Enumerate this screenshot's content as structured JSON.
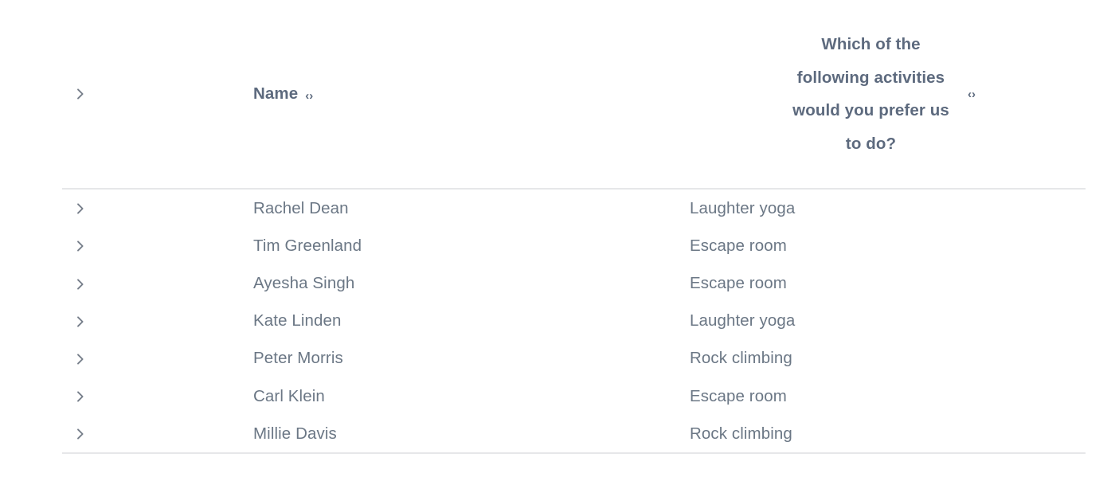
{
  "table": {
    "columns": [
      {
        "key": "expand",
        "label": "",
        "sortable": false
      },
      {
        "key": "name",
        "label": "Name",
        "sortable": true,
        "sort_icon": "‹›"
      },
      {
        "key": "question",
        "label": "Which of the following activities would you prefer us to do?",
        "sortable": true,
        "sort_icon": "‹›"
      }
    ],
    "header": {
      "expand_icon": "chevron-right-icon",
      "name_label": "Name",
      "name_sort": "‹›",
      "question_label": "Which of the following activities would you prefer us to do?",
      "question_sort": "‹›"
    },
    "rows": [
      {
        "expand_icon": "chevron-right-icon",
        "name": "Rachel Dean",
        "answer": "Laughter yoga"
      },
      {
        "expand_icon": "chevron-right-icon",
        "name": "Tim Greenland",
        "answer": "Escape room"
      },
      {
        "expand_icon": "chevron-right-icon",
        "name": "Ayesha Singh",
        "answer": "Escape room"
      },
      {
        "expand_icon": "chevron-right-icon",
        "name": "Kate Linden",
        "answer": "Laughter yoga"
      },
      {
        "expand_icon": "chevron-right-icon",
        "name": "Peter Morris",
        "answer": "Rock climbing"
      },
      {
        "expand_icon": "chevron-right-icon",
        "name": "Carl Klein",
        "answer": "Escape room"
      },
      {
        "expand_icon": "chevron-right-icon",
        "name": "Millie Davis",
        "answer": "Rock climbing"
      }
    ],
    "row_count": 7
  },
  "colors": {
    "header_text": "#5d6a7e",
    "body_text": "#6b7785",
    "divider": "#e6e7e9",
    "chevron": "#767e8a",
    "background": "#ffffff"
  }
}
